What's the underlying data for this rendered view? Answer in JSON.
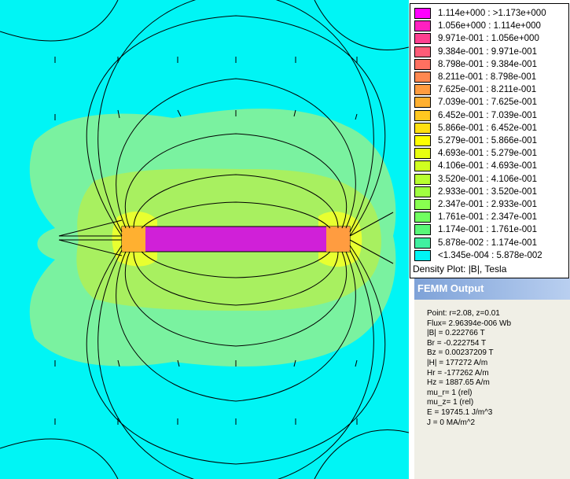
{
  "legend": {
    "entries": [
      {
        "label": "1.114e+000 : >1.173e+000",
        "color": "#ff00ff"
      },
      {
        "label": "1.056e+000 : 1.114e+000",
        "color": "#ff20c0"
      },
      {
        "label": "9.971e-001 : 1.056e+000",
        "color": "#ff4090"
      },
      {
        "label": "9.384e-001 : 9.971e-001",
        "color": "#ff5c78"
      },
      {
        "label": "8.798e-001 : 9.384e-001",
        "color": "#ff7060"
      },
      {
        "label": "8.211e-001 : 8.798e-001",
        "color": "#ff8850"
      },
      {
        "label": "7.625e-001 : 8.211e-001",
        "color": "#ff9c40"
      },
      {
        "label": "7.039e-001 : 7.625e-001",
        "color": "#ffb030"
      },
      {
        "label": "6.452e-001 : 7.039e-001",
        "color": "#ffc820"
      },
      {
        "label": "5.866e-001 : 6.452e-001",
        "color": "#ffe010"
      },
      {
        "label": "5.279e-001 : 5.866e-001",
        "color": "#ffff00"
      },
      {
        "label": "4.693e-001 : 5.279e-001",
        "color": "#e8ff10"
      },
      {
        "label": "4.106e-001 : 4.693e-001",
        "color": "#d0ff20"
      },
      {
        "label": "3.520e-001 : 4.106e-001",
        "color": "#b8ff30"
      },
      {
        "label": "2.933e-001 : 3.520e-001",
        "color": "#a0ff40"
      },
      {
        "label": "2.347e-001 : 2.933e-001",
        "color": "#88ff50"
      },
      {
        "label": "1.761e-001 : 2.347e-001",
        "color": "#70ff60"
      },
      {
        "label": "1.174e-001 : 1.761e-001",
        "color": "#58f878"
      },
      {
        "label": "5.878e-002 : 1.174e-001",
        "color": "#40f0a0"
      },
      {
        "label": "<1.345e-004 : 5.878e-002",
        "color": "#00f5f5"
      }
    ],
    "caption": "Density Plot: |B|, Tesla"
  },
  "output": {
    "title": "FEMM Output",
    "lines": [
      "Point: r=2.08, z=0.01",
      "Flux= 2.96394e-006 Wb",
      "|B| = 0.222766 T",
      "Br  = -0.222754 T",
      "Bz  = 0.00237209 T",
      "|H| = 177272 A/m",
      "Hr  = -177262 A/m",
      "Hz  = 1887.65 A/m",
      "mu_r= 1 (rel)",
      "mu_z= 1 (rel)",
      "E   = 19745.1 J/m^3",
      "J   = 0 MA/m^2"
    ]
  },
  "colors": {
    "background": "#00f5f5",
    "low_field": "#58f878",
    "mid_field": "#a0ff40",
    "high_field": "#ff20c0"
  }
}
